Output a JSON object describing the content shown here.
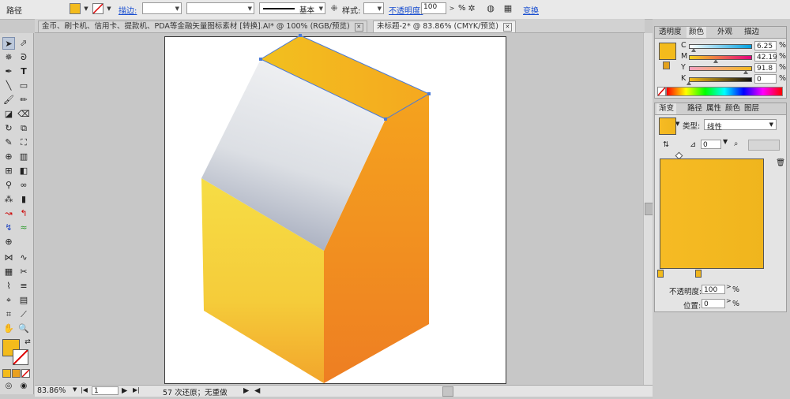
{
  "control_bar": {
    "object_type": "路径",
    "stroke_label": "描边:",
    "stroke_style": "基本",
    "style_label": "样式:",
    "opacity_label": "不透明度:",
    "opacity_value": "100",
    "opacity_unit": "%",
    "transform_label": "变换"
  },
  "tabs": [
    {
      "label": "金币、刷卡机、信用卡、提款机、PDA等金融矢量图标素材 [转换].AI* @ 100% (RGB/预览)"
    },
    {
      "label": "未标题-2* @ 83.86% (CMYK/预览)"
    }
  ],
  "status": {
    "zoom": "83.86%",
    "page": "1",
    "history": "57 次还原；无重做"
  },
  "color_panel": {
    "tabs": [
      "透明度",
      "颜色",
      "外观",
      "描边"
    ],
    "channels": [
      {
        "name": "C",
        "value": "6.25",
        "unit": "%"
      },
      {
        "name": "M",
        "value": "42.19",
        "unit": "%"
      },
      {
        "name": "Y",
        "value": "91.8",
        "unit": "%"
      },
      {
        "name": "K",
        "value": "0",
        "unit": "%"
      }
    ]
  },
  "gradient_panel": {
    "tabs": [
      "渐变",
      "路径",
      "属性",
      "颜色",
      "图层"
    ],
    "type_label": "类型:",
    "type_value": "线性",
    "angle_value": "0",
    "opacity_label": "不透明度:",
    "opacity_value": "100",
    "location_label": "位置:",
    "location_value": "0",
    "unit": "%"
  },
  "colors": {
    "fill": "#f3bb1c",
    "accent_link": "#1a4fd0",
    "top_face_a": "#f2c01f",
    "top_face_b": "#f5a81f",
    "front_face_a": "#f6dd45",
    "front_face_b": "#f2a52b",
    "right_face_a": "#f5a31e",
    "right_face_b": "#ee7e22",
    "slope_a": "#f1f2f4",
    "slope_b": "#9ea5b8",
    "gradient_a": "#f6bb24",
    "gradient_b": "#f0b51d"
  },
  "icons": {
    "tools": [
      "selection-icon",
      "direct-select-icon",
      "magic-wand-icon",
      "lasso-icon",
      "pen-icon",
      "type-icon",
      "line-icon",
      "rectangle-icon",
      "paintbrush-icon",
      "pencil-icon",
      "blob-brush-icon",
      "eraser-icon",
      "rotate-icon",
      "scale-icon",
      "warp-icon",
      "free-transform-icon",
      "shape-builder-icon",
      "perspective-icon",
      "mesh-icon",
      "gradient-icon",
      "eyedropper-icon",
      "blend-icon",
      "symbol-sprayer-icon",
      "graph-icon",
      "artboard-icon",
      "slice-icon",
      "hand-icon",
      "zoom-icon"
    ]
  }
}
